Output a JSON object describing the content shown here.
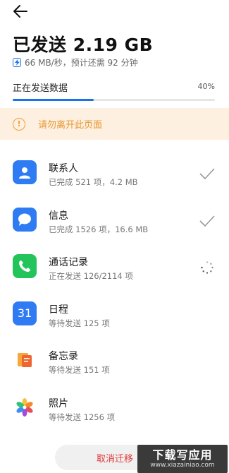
{
  "header": {
    "back_icon": "arrow-left-icon",
    "title": "已发送 2.19 GB",
    "speed_text": "66 MB/秒，预计还需 92 分钟"
  },
  "progress": {
    "label": "正在发送数据",
    "percent_text": "40%",
    "value": 0.4,
    "accent": "#1a73e8"
  },
  "warning": {
    "text": "请勿离开此页面",
    "color": "#e8952f",
    "background": "#fdf0e0"
  },
  "items": [
    {
      "name": "联系人",
      "status": "已完成 521 项，4.2 MB",
      "state": "done",
      "icon": "contacts-icon"
    },
    {
      "name": "信息",
      "status": "已完成 1526 项，16.6 MB",
      "state": "done",
      "icon": "messages-icon"
    },
    {
      "name": "通话记录",
      "status": "正在发送 126/2114 项",
      "state": "sending",
      "icon": "phone-icon"
    },
    {
      "name": "日程",
      "status": "等待发送 125 项",
      "state": "waiting",
      "icon": "calendar-icon",
      "icon_text": "31"
    },
    {
      "name": "备忘录",
      "status": "等待发送 151 项",
      "state": "waiting",
      "icon": "notes-icon"
    },
    {
      "name": "照片",
      "status": "等待发送 1256 项",
      "state": "waiting",
      "icon": "photos-icon"
    }
  ],
  "footer": {
    "cancel_label": "取消迁移",
    "cancel_color": "#e23b3b"
  },
  "watermark": {
    "line1": "下载写应用",
    "line2": "www.xiazainiao.com"
  }
}
